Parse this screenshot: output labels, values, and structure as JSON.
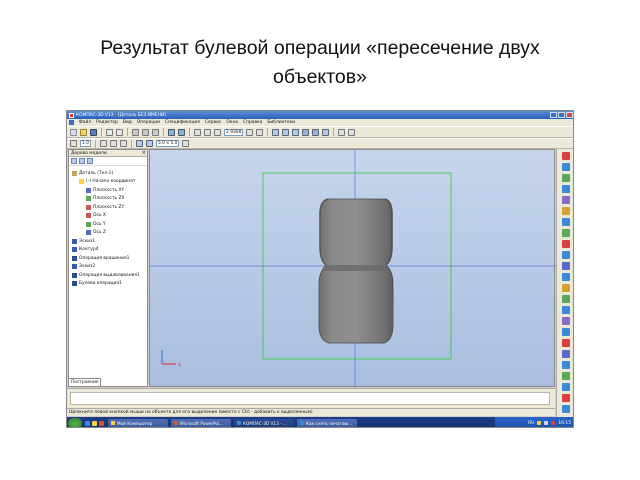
{
  "slide": {
    "title_line1": "Результат  булевой операции «пересечение двух",
    "title_line2": "объектов»"
  },
  "window": {
    "title": "КОМПАС-3D V13 - [Деталь БЕЗ ИМЕНИ]"
  },
  "menu": [
    "Файл",
    "Редактор",
    "Вид",
    "Операции",
    "Спецификация",
    "Сервис",
    "Окно",
    "Справка",
    "Библиотеки"
  ],
  "toolbar": {
    "zoom_value": "2.9308",
    "step_value": "1.0",
    "scale_value": "5.0 x 5.0"
  },
  "model_tree": {
    "header": "Дерево модели",
    "tab_label": "Построение",
    "nodes": [
      {
        "label": "Деталь (Тел-1)",
        "level": 0,
        "icon_color": "#c0a060"
      },
      {
        "label": "(-) Начало координат",
        "level": 1,
        "icon_color": "#ffd040"
      },
      {
        "label": "Плоскость XY",
        "level": 2,
        "icon_color": "#5a6ac8"
      },
      {
        "label": "Плоскость ZX",
        "level": 2,
        "icon_color": "#5aa85a"
      },
      {
        "label": "Плоскость ZY",
        "level": 2,
        "icon_color": "#c85a5a"
      },
      {
        "label": "Ось X",
        "level": 2,
        "icon_color": "#c85a5a"
      },
      {
        "label": "Ось Y",
        "level": 2,
        "icon_color": "#5aa85a"
      },
      {
        "label": "Ось Z",
        "level": 2,
        "icon_color": "#5a6ac8"
      },
      {
        "label": "Эскиз1",
        "level": 0,
        "icon_color": "#3a5ab8"
      },
      {
        "label": "Контур4",
        "level": 0,
        "icon_color": "#3a5ab8"
      },
      {
        "label": "Операция вращения1",
        "level": 0,
        "icon_color": "#2a4a98"
      },
      {
        "label": "Эскиз2",
        "level": 0,
        "icon_color": "#3a5ab8"
      },
      {
        "label": "Операция выдавливания1",
        "level": 0,
        "icon_color": "#2a4a98"
      },
      {
        "label": "Булева операция1",
        "level": 0,
        "icon_color": "#2a4a98"
      }
    ]
  },
  "status_bar": {
    "hint": "Щелкните левой кнопкой мыши на объекте для его выделения (вместе с Ctrl - добавить к выделенным)"
  },
  "taskbar": {
    "tasks": [
      {
        "label": "Мой Компьютер",
        "icon_color": "#ffd040",
        "active": false
      },
      {
        "label": "Microsoft PowerPoi...",
        "icon_color": "#d9532c",
        "active": false
      },
      {
        "label": "КОМПАС-3D V13 - ...",
        "icon_color": "#3a8ad8",
        "active": true
      },
      {
        "label": "Как снять печатаю...",
        "icon_color": "#3a8ad8",
        "active": false
      }
    ],
    "language": "RU",
    "clock": "16:15"
  },
  "colors": {
    "viewport_top": "#c6d5ec",
    "part_body": "#7d7d7d",
    "bounding_box": "#33cc33",
    "axis_line": "#5a7ad8"
  }
}
